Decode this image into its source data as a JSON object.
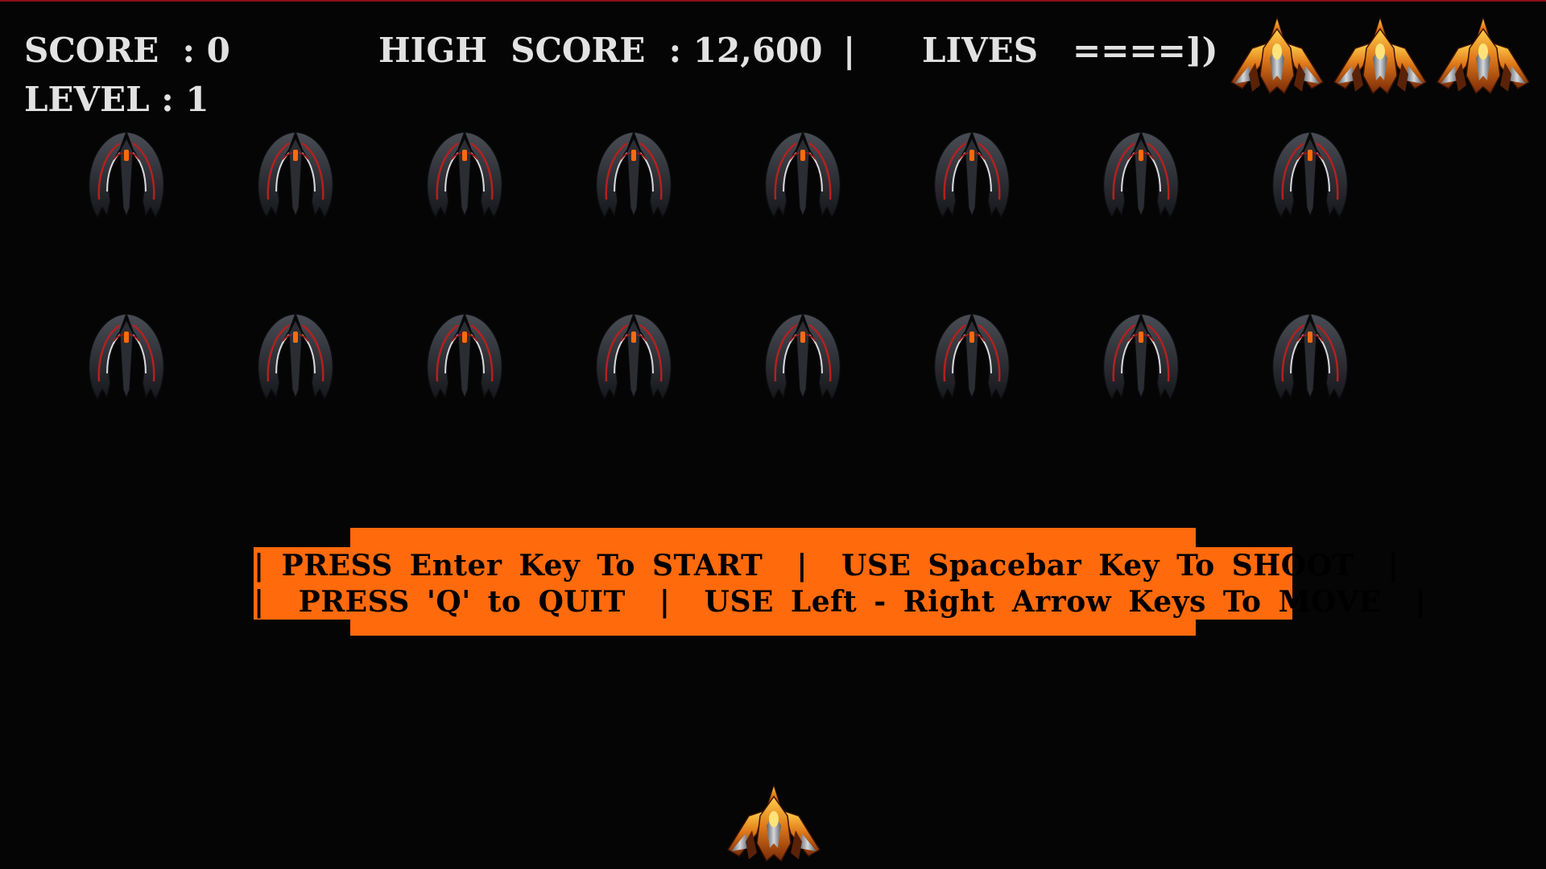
{
  "hud": {
    "score": "SCORE  : 0",
    "level": "LEVEL : 1",
    "high_score": "HIGH  SCORE  : 12,600",
    "divider": "|",
    "lives_label": "LIVES",
    "lives_gauge": "====])",
    "lives_remaining": 3
  },
  "aliens": {
    "rows": 2,
    "per_row": 8
  },
  "instructions": {
    "line1": "| PRESS Enter Key To START  |  USE Spacebar Key To SHOOT  |",
    "line2": "|  PRESS 'Q' to QUIT  |  USE Left - Right Arrow Keys To MOVE  |"
  },
  "colors": {
    "background": "#050505",
    "hud_text": "#e2e2e2",
    "banner": "#ff6a0d",
    "border": "#8a0f1a"
  },
  "icons": {
    "player": "player-ship-icon",
    "life": "life-ship-icon",
    "enemy": "alien-ship-icon"
  }
}
